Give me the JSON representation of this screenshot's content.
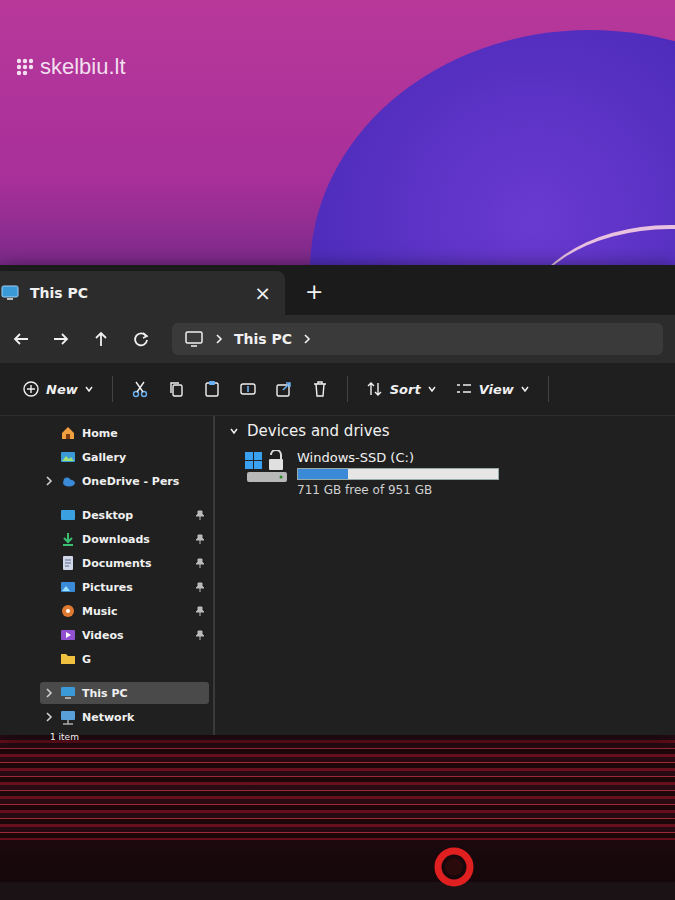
{
  "watermark": "skelbiu.lt",
  "window": {
    "title": "This PC",
    "close": "×",
    "new_tab": "+"
  },
  "address": {
    "crumbs": [
      "This PC"
    ]
  },
  "toolbar": {
    "new": "New",
    "sort": "Sort",
    "view": "View"
  },
  "sidebar": {
    "sections": [
      [
        {
          "label": "Home",
          "expander": false,
          "pinned": false,
          "selected": false
        },
        {
          "label": "Gallery",
          "expander": false,
          "pinned": false,
          "selected": false
        },
        {
          "label": "OneDrive - Pers",
          "expander": true,
          "pinned": false,
          "selected": false
        }
      ],
      [
        {
          "label": "Desktop",
          "expander": false,
          "pinned": true,
          "selected": false
        },
        {
          "label": "Downloads",
          "expander": false,
          "pinned": true,
          "selected": false
        },
        {
          "label": "Documents",
          "expander": false,
          "pinned": true,
          "selected": false
        },
        {
          "label": "Pictures",
          "expander": false,
          "pinned": true,
          "selected": false
        },
        {
          "label": "Music",
          "expander": false,
          "pinned": true,
          "selected": false
        },
        {
          "label": "Videos",
          "expander": false,
          "pinned": true,
          "selected": false
        },
        {
          "label": "G",
          "expander": false,
          "pinned": false,
          "selected": false
        }
      ],
      [
        {
          "label": "This PC",
          "expander": true,
          "pinned": false,
          "selected": true
        },
        {
          "label": "Network",
          "expander": true,
          "pinned": false,
          "selected": false
        }
      ]
    ]
  },
  "content": {
    "group": "Devices and drives",
    "expanded": true,
    "drives": [
      {
        "name": "Windows-SSD (C:)",
        "level": 0.25,
        "free": "711 GB free of 951 GB",
        "selected": false
      }
    ]
  },
  "status_bar": {
    "count": "1 item"
  }
}
